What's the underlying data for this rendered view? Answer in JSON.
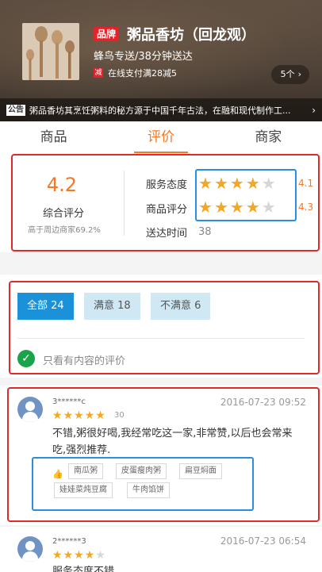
{
  "header": {
    "brand_badge": "品牌",
    "shop_name": "粥品香坊（回龙观）",
    "delivery": "蜂鸟专送/38分钟送达",
    "promo_icon": "减",
    "promo_text": "在线支付满28减5",
    "activity_count": "5个",
    "notice_tag": "公告",
    "notice_text": "粥品香坊其烹饪粥料的秘方源于中国千年古法，在融和现代制作工..."
  },
  "tabs": [
    {
      "label": "商品"
    },
    {
      "label": "评价"
    },
    {
      "label": "商家"
    }
  ],
  "summary": {
    "overall_score": "4.2",
    "overall_label": "综合评分",
    "compare_text": "高于周边商家69.2%",
    "service_label": "服务态度",
    "service_score": "4.1",
    "service_stars": 4,
    "product_label": "商品评分",
    "product_score": "4.3",
    "product_stars": 4,
    "delivery_label": "送达时间",
    "delivery_time": "38"
  },
  "filter": {
    "all": "全部 24",
    "positive": "满意 18",
    "negative": "不满意 6",
    "only_content": "只看有内容的评价"
  },
  "reviews": [
    {
      "user": "3******c",
      "time": "2016-07-23 09:52",
      "stars": 5,
      "score": "30",
      "text": "不错,粥很好喝,我经常吃这一家,非常赞,以后也会常来吃,强烈推荐.",
      "dishes": [
        "南瓜粥",
        "皮蛋瘦肉粥",
        "扁豆焖面",
        "娃娃菜炖豆腐",
        "牛肉馅饼"
      ]
    },
    {
      "user": "2******3",
      "time": "2016-07-23 06:54",
      "stars": 4,
      "text": "服务态度不错"
    }
  ],
  "colors": {
    "accent": "#f07a2a",
    "star": "#f5a623",
    "filter_active": "#1a91d9",
    "filter_inactive": "#cfe8f3",
    "brand_red": "#e7212a"
  }
}
